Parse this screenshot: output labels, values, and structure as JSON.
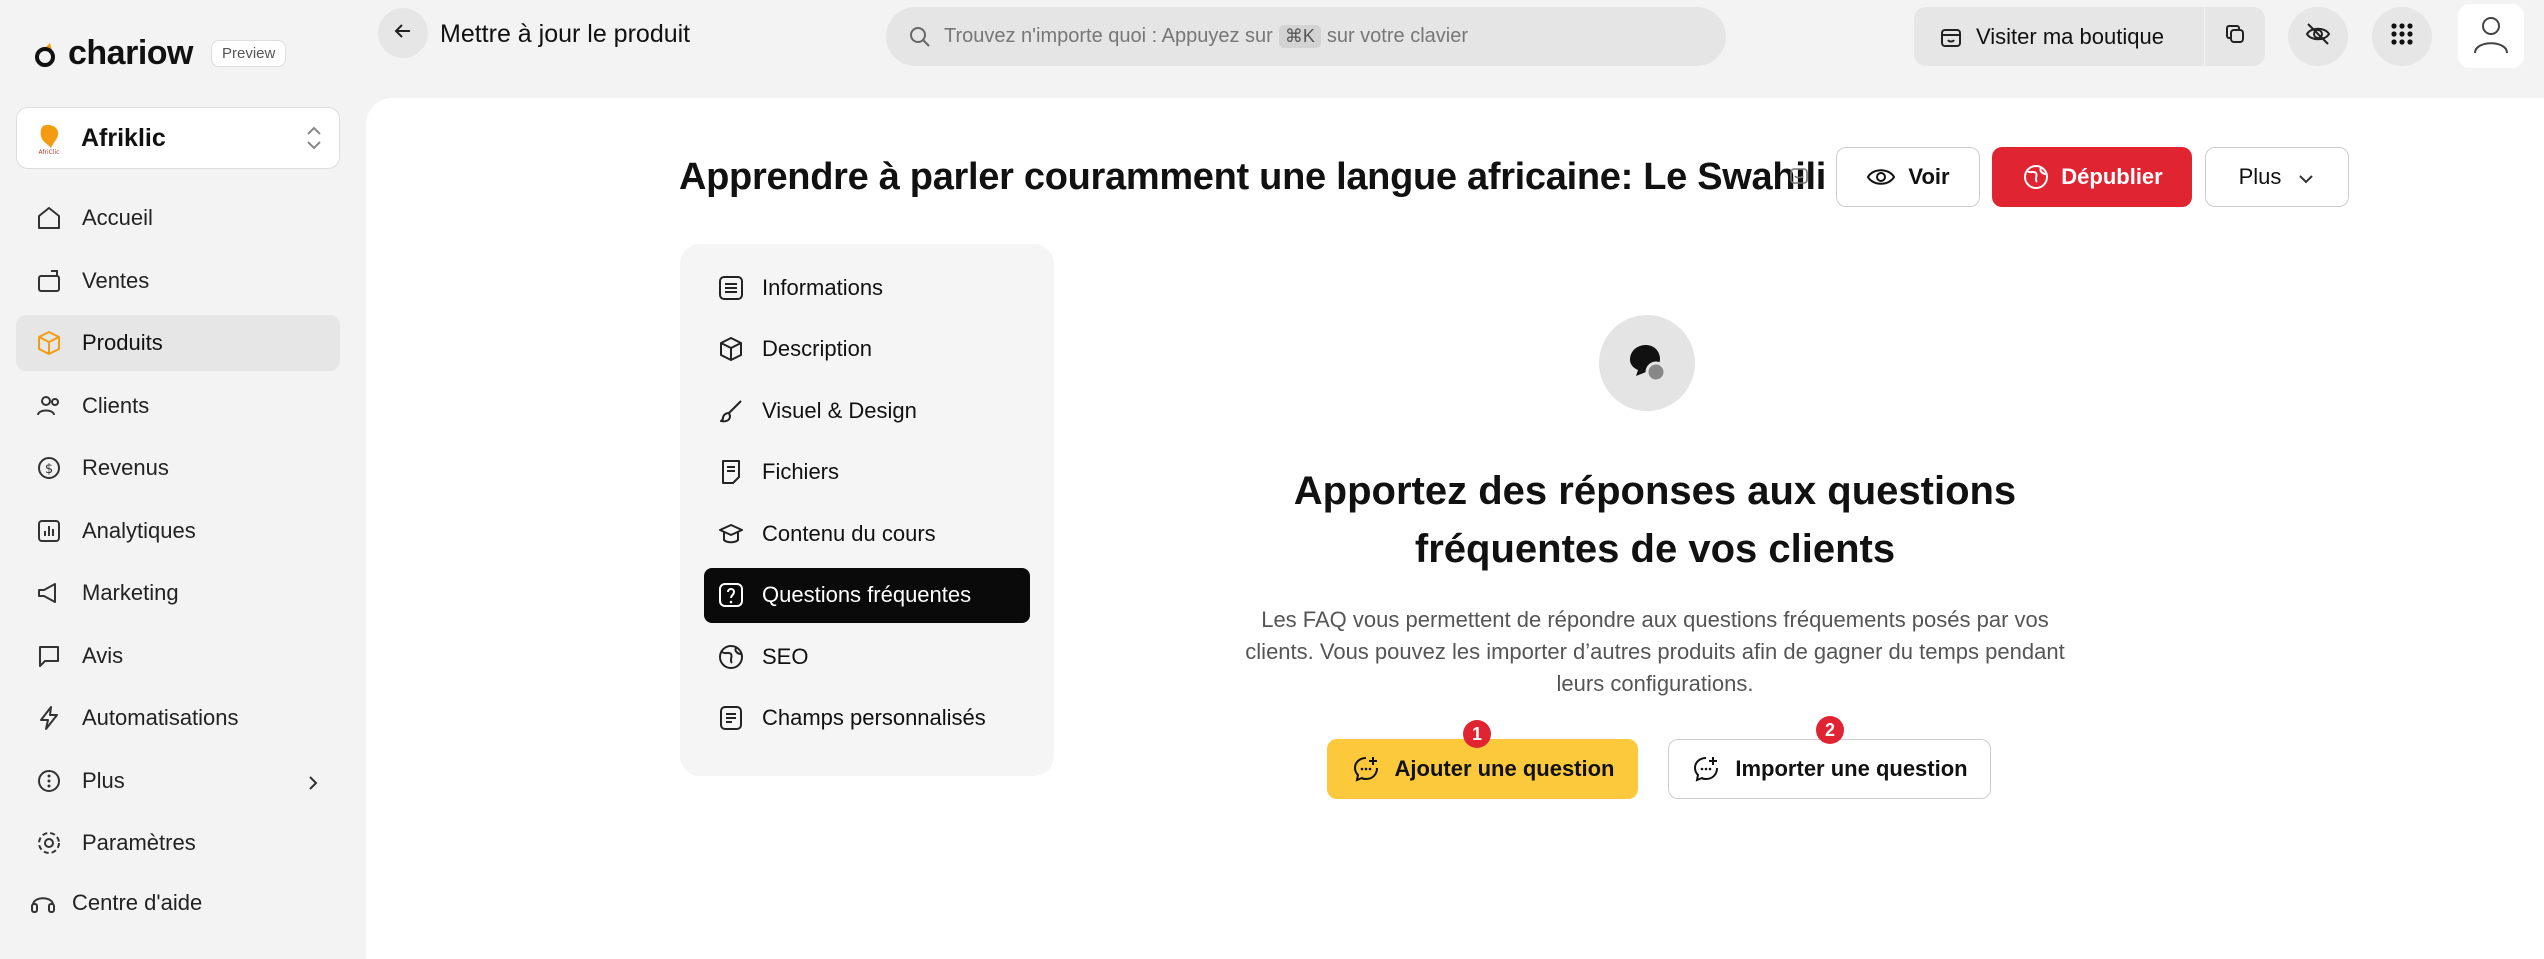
{
  "brand": {
    "name": "chariow",
    "badge": "Preview",
    "accent": "#f39c12"
  },
  "store": {
    "name": "Afriklic"
  },
  "sidebar": {
    "items": [
      {
        "label": "Accueil",
        "icon": "home-icon"
      },
      {
        "label": "Ventes",
        "icon": "sales-icon"
      },
      {
        "label": "Produits",
        "icon": "box-icon",
        "active": true
      },
      {
        "label": "Clients",
        "icon": "users-icon"
      },
      {
        "label": "Revenus",
        "icon": "revenue-icon"
      },
      {
        "label": "Analytiques",
        "icon": "chart-icon"
      },
      {
        "label": "Marketing",
        "icon": "megaphone-icon"
      },
      {
        "label": "Avis",
        "icon": "message-icon"
      },
      {
        "label": "Automatisations",
        "icon": "bolt-icon"
      },
      {
        "label": "Plus",
        "icon": "more-icon"
      },
      {
        "label": "Paramètres",
        "icon": "gear-icon"
      }
    ],
    "help_label": "Centre d'aide"
  },
  "topbar": {
    "title": "Mettre à jour le produit",
    "search_prefix": "Trouvez n'importe quoi : Appuyez sur",
    "search_kbd": "⌘K",
    "search_suffix": "sur votre clavier",
    "visit_label": "Visiter ma boutique"
  },
  "product": {
    "title": "Apprendre à parler couramment une langue africaine: Le Swahili",
    "voir_label": "Voir",
    "depublier_label": "Dépublier",
    "plus_label": "Plus"
  },
  "tabs": [
    {
      "label": "Informations",
      "icon": "list-icon"
    },
    {
      "label": "Description",
      "icon": "cube-icon"
    },
    {
      "label": "Visuel & Design",
      "icon": "brush-icon"
    },
    {
      "label": "Fichiers",
      "icon": "file-icon"
    },
    {
      "label": "Contenu du cours",
      "icon": "course-icon"
    },
    {
      "label": "Questions fréquentes",
      "icon": "question-icon",
      "active": true
    },
    {
      "label": "SEO",
      "icon": "globe-icon"
    },
    {
      "label": "Champs personnalisés",
      "icon": "fields-icon"
    }
  ],
  "faq": {
    "heading_line1": "Apportez des réponses aux questions",
    "heading_line2": "fréquentes de vos clients",
    "desc_line1": "Les FAQ vous permettent de répondre aux questions fréquements posés par vos",
    "desc_line2": "clients. Vous pouvez les importer d’autres produits afin de gagner du temps pendant",
    "desc_line3": "leurs configurations.",
    "add_label": "Ajouter une question",
    "import_label": "Importer une question",
    "add_step": "1",
    "import_step": "2"
  },
  "colors": {
    "danger": "#e02432",
    "primary_yellow": "#fbc93b",
    "active_dark": "#0a0a0a"
  }
}
